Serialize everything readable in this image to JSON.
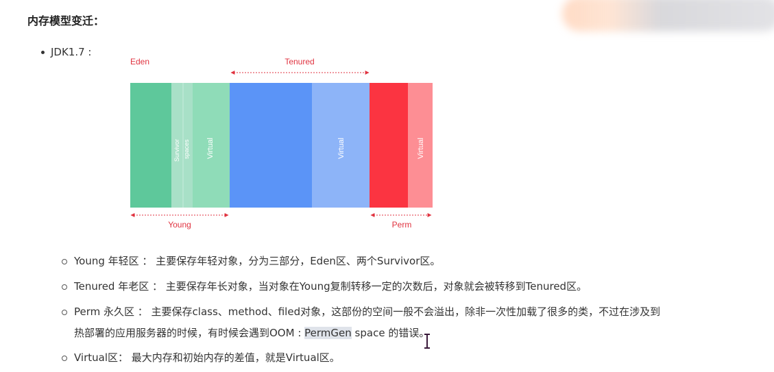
{
  "heading": "内存模型变迁：",
  "version_item": "JDK1.7 :",
  "diagram": {
    "labels": {
      "eden": "Eden",
      "tenured": "Tenured",
      "young": "Young",
      "perm": "Perm",
      "survivor_1": "Survivor",
      "survivor_2": "spaces",
      "virtual": "Virtual"
    },
    "colors": {
      "eden": "#5ec89b",
      "survivor": "#a8e0c7",
      "young_virtual": "#8fdcb8",
      "tenured": "#5b94f7",
      "tenured_virtual": "#8db4f8",
      "perm": "#fb3441",
      "perm_virtual": "#fd8e94",
      "annotation": "#e0323f"
    }
  },
  "items": [
    {
      "line1": "Young 年轻区 ： 主要保存年轻对象，分为三部分，Eden区、两个Survivor区。"
    },
    {
      "line1": "Tenured 年老区 ： 主要保存年长对象，当对象在Young复制转移一定的次数后，对象就会被转移到Tenured区。"
    },
    {
      "line1": "Perm 永久区 ： 主要保存class、method、filed对象，这部份的空间一般不会溢出，除非一次性加载了很多的类，不过在涉及到",
      "line2_pre": "热部署的应用服务器的时候，有时候会遇到OOM : ",
      "line2_hl": "PermGen",
      "line2_post": " space 的错误。"
    },
    {
      "line1": "Virtual区： 最大内存和初始内存的差值，就是Virtual区。"
    }
  ]
}
